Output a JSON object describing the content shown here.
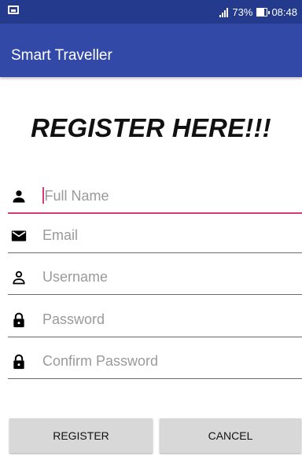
{
  "status_bar": {
    "battery": "73%",
    "time": "08:48"
  },
  "app_bar": {
    "title": "Smart Traveller"
  },
  "heading": "REGISTER HERE!!!",
  "form": {
    "full_name": {
      "placeholder": "Full Name",
      "icon": "person-icon"
    },
    "email": {
      "placeholder": "Email",
      "icon": "mail-icon"
    },
    "username": {
      "placeholder": "Username",
      "icon": "person-outline-icon"
    },
    "password": {
      "placeholder": "Password",
      "icon": "lock-icon"
    },
    "confirm_password": {
      "placeholder": "Confirm Password",
      "icon": "lock-icon"
    }
  },
  "buttons": {
    "register": "REGISTER",
    "cancel": "CANCEL"
  },
  "colors": {
    "primary_dark": "#243a8c",
    "primary": "#3349a7",
    "accent": "#d63b76"
  }
}
